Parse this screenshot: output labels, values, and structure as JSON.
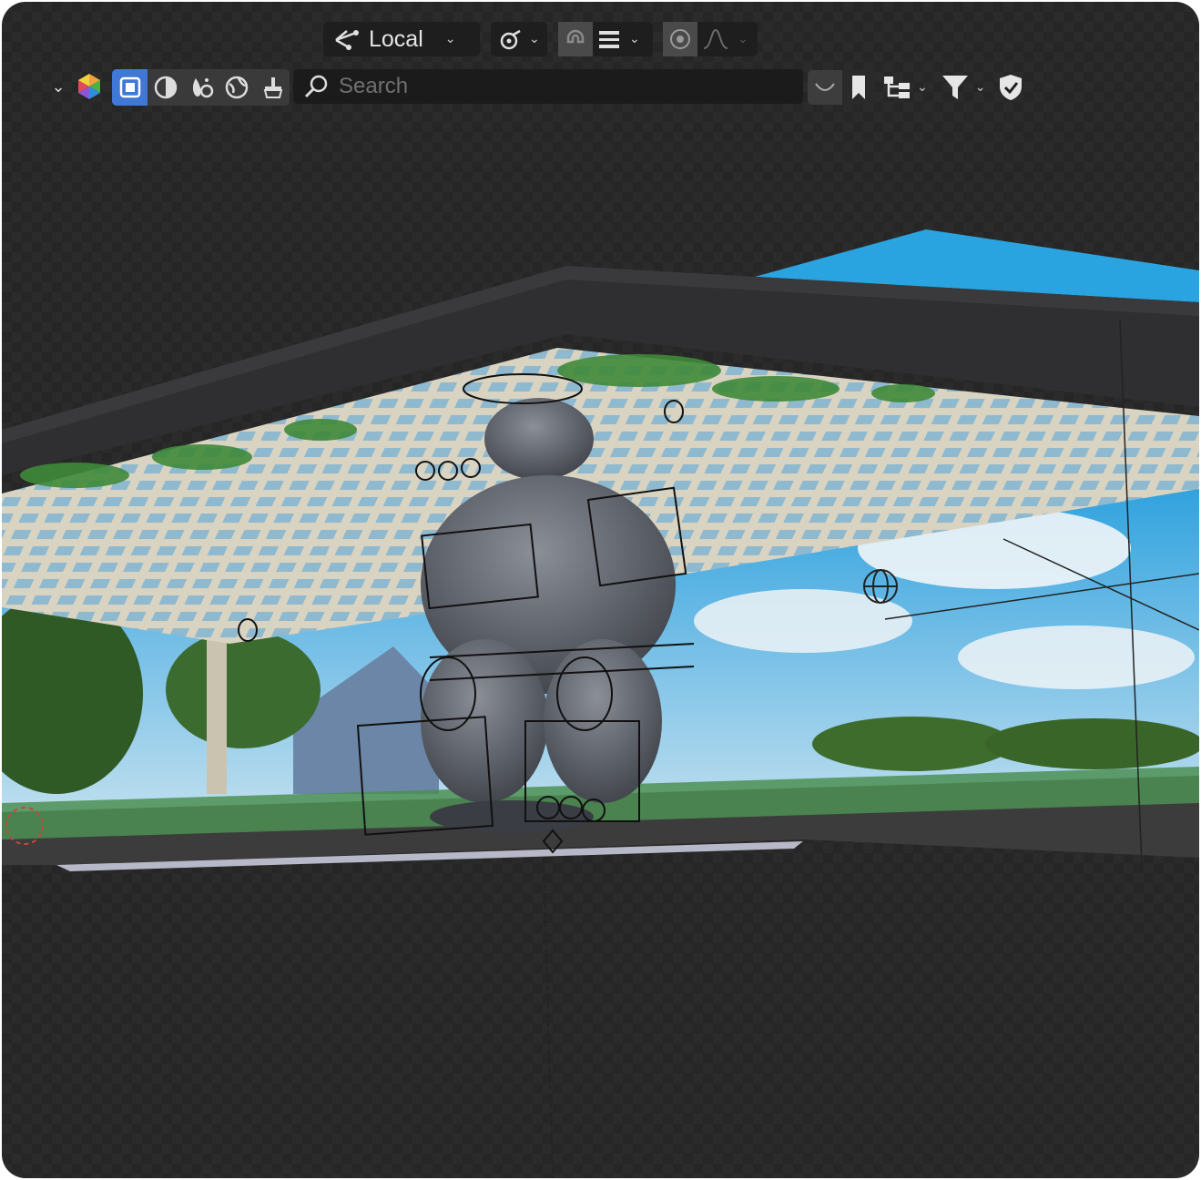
{
  "header": {
    "transform_orientation": {
      "label": "Local",
      "icon": "orientation-icon",
      "caret": "⌄"
    },
    "pivot": {
      "icon": "pivot-point-icon",
      "caret": "⌄"
    },
    "snap": {
      "icon": "snap-magnet-icon",
      "increment_icon": "snap-increment-icon",
      "caret": "⌄"
    },
    "proportional": {
      "icon": "proportional-edit-icon",
      "falloff_icon": "falloff-curve-icon"
    }
  },
  "outliner_bar": {
    "collapse_icon": "chevron-down-icon",
    "display_mode_icon": "blender-data-icon",
    "filters": [
      {
        "name": "object-select-icon",
        "selected": true
      },
      {
        "name": "material-icon",
        "selected": false
      },
      {
        "name": "particles-icon",
        "selected": false
      },
      {
        "name": "world-icon",
        "selected": false
      },
      {
        "name": "brush-icon",
        "selected": false
      }
    ],
    "search": {
      "placeholder": "Search",
      "value": ""
    },
    "right_icons": [
      "curve-icon",
      "bookmark-icon",
      "hierarchy-icon",
      "filter-icon",
      "shield-check-icon"
    ]
  },
  "colors": {
    "accent": "#3f78d6",
    "panel": "#1e1e1e",
    "viewport_bg": "#2b2b2b"
  }
}
